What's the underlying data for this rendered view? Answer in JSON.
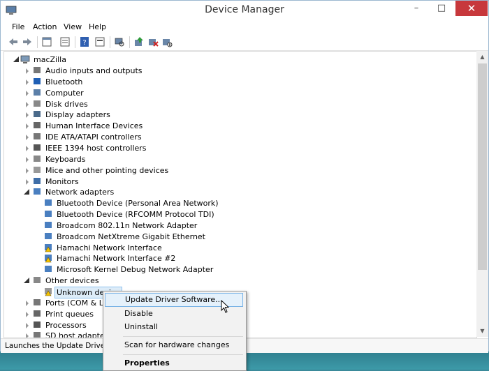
{
  "window": {
    "title": "Device Manager",
    "min": "–",
    "max": "□",
    "close": "✕"
  },
  "menu": [
    "File",
    "Action",
    "View",
    "Help"
  ],
  "toolbar": [
    "back-icon",
    "forward-icon",
    "properties-icon",
    "show-hide-icon",
    "help-icon",
    "console-icon",
    "scan-hardware-icon",
    "update-driver-icon",
    "uninstall-icon",
    "disable-icon"
  ],
  "tree": {
    "root": "macZilla",
    "categories": [
      {
        "label": "Audio inputs and outputs",
        "icon": "speaker-icon",
        "expanded": false
      },
      {
        "label": "Bluetooth",
        "icon": "bluetooth-icon",
        "expanded": false
      },
      {
        "label": "Computer",
        "icon": "computer-icon",
        "expanded": false
      },
      {
        "label": "Disk drives",
        "icon": "disk-drive-icon",
        "expanded": false
      },
      {
        "label": "Display adapters",
        "icon": "display-adapter-icon",
        "expanded": false
      },
      {
        "label": "Human Interface Devices",
        "icon": "hid-icon",
        "expanded": false
      },
      {
        "label": "IDE ATA/ATAPI controllers",
        "icon": "ide-icon",
        "expanded": false
      },
      {
        "label": "IEEE 1394 host controllers",
        "icon": "ieee1394-icon",
        "expanded": false
      },
      {
        "label": "Keyboards",
        "icon": "keyboard-icon",
        "expanded": false
      },
      {
        "label": "Mice and other pointing devices",
        "icon": "mouse-icon",
        "expanded": false
      },
      {
        "label": "Monitors",
        "icon": "monitor-icon",
        "expanded": false
      },
      {
        "label": "Network adapters",
        "icon": "network-icon",
        "expanded": true
      },
      {
        "label": "Bluetooth Device (Personal Area Network)",
        "icon": "network-icon",
        "child": true
      },
      {
        "label": "Bluetooth Device (RFCOMM Protocol TDI)",
        "icon": "network-icon",
        "child": true
      },
      {
        "label": "Broadcom 802.11n Network Adapter",
        "icon": "network-icon",
        "child": true
      },
      {
        "label": "Broadcom NetXtreme Gigabit Ethernet",
        "icon": "network-icon",
        "child": true
      },
      {
        "label": "Hamachi Network Interface",
        "icon": "warning-network-icon",
        "child": true
      },
      {
        "label": "Hamachi Network Interface #2",
        "icon": "warning-network-icon",
        "child": true
      },
      {
        "label": "Microsoft Kernel Debug Network Adapter",
        "icon": "network-icon",
        "child": true
      },
      {
        "label": "Other devices",
        "icon": "other-devices-icon",
        "expanded": true
      },
      {
        "label": "Unknown device",
        "icon": "warning-device-icon",
        "child": true,
        "selected": true
      },
      {
        "label": "Ports (COM & LPT)",
        "icon": "port-icon",
        "expanded": false
      },
      {
        "label": "Print queues",
        "icon": "printer-icon",
        "expanded": false
      },
      {
        "label": "Processors",
        "icon": "processor-icon",
        "expanded": false
      },
      {
        "label": "SD host adapters",
        "icon": "sd-icon",
        "expanded": false
      }
    ]
  },
  "context_menu": {
    "update": "Update Driver Software...",
    "disable": "Disable",
    "uninstall": "Uninstall",
    "scan": "Scan for hardware changes",
    "properties": "Properties"
  },
  "status": "Launches the Update Driver Se"
}
